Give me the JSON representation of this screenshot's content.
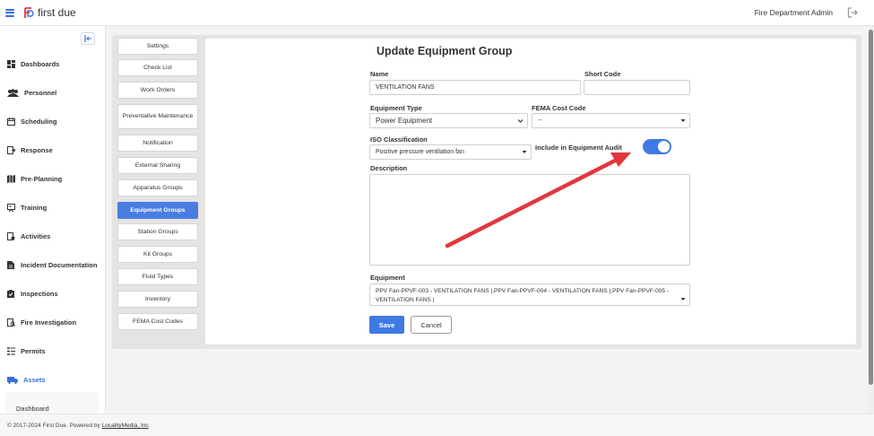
{
  "app": {
    "logo_text": "first due",
    "user": "Fire Department Admin",
    "colors": {
      "accent": "#3f7ae4",
      "annotation_arrow": "#e2373c"
    }
  },
  "sidebar": {
    "items": [
      {
        "label": "Dashboards",
        "icon": "dashboard-grid-icon"
      },
      {
        "label": "Personnel",
        "icon": "people-icon"
      },
      {
        "label": "Scheduling",
        "icon": "calendar-icon"
      },
      {
        "label": "Response",
        "icon": "response-icon"
      },
      {
        "label": "Pre-Planning",
        "icon": "map-icon"
      },
      {
        "label": "Training",
        "icon": "training-icon"
      },
      {
        "label": "Activities",
        "icon": "activities-icon"
      },
      {
        "label": "Incident Documentation",
        "icon": "document-icon"
      },
      {
        "label": "Inspections",
        "icon": "checklist-icon"
      },
      {
        "label": "Fire Investigation",
        "icon": "investigation-icon"
      },
      {
        "label": "Permits",
        "icon": "permits-icon"
      },
      {
        "label": "Assets",
        "icon": "truck-icon"
      }
    ],
    "active": "Assets",
    "sub_item": "Dashboard"
  },
  "subnav": {
    "items": [
      "Settings",
      "Check List",
      "Work Orders",
      "Preventative Maintenance",
      "Notification",
      "External Sharing",
      "Apparatus Groups",
      "Equipment Groups",
      "Station Groups",
      "Kit Groups",
      "Fluid Types",
      "Inventory",
      "FEMA Cost Codes"
    ],
    "active": "Equipment Groups"
  },
  "form": {
    "title": "Update Equipment Group",
    "name_label": "Name",
    "name_value": "VENTILATION FANS",
    "short_code_label": "Short Code",
    "short_code_value": "",
    "equipment_type_label": "Equipment Type",
    "equipment_type_value": "Power Equipment",
    "fema_label": "FEMA Cost Code",
    "fema_value": "--",
    "iso_label": "ISO Classification",
    "iso_value": "Positive pressure ventilation fan",
    "audit_label": "Include in Equipment Audit",
    "audit_enabled": true,
    "description_label": "Description",
    "description_value": "",
    "equipment_label": "Equipment",
    "equipment_value": "PPV Fan-PPVF-003 - VENTILATION FANS |,PPV Fan-PPVF-004 - VENTILATION FANS |,PPV Fan-PPVF-005 - VENTILATION FANS |",
    "save_label": "Save",
    "cancel_label": "Cancel"
  },
  "footer": {
    "copyright": "© 2017-2024 First Due. Powered by ",
    "link": "LocalityMedia, Inc",
    "suffix": "."
  }
}
